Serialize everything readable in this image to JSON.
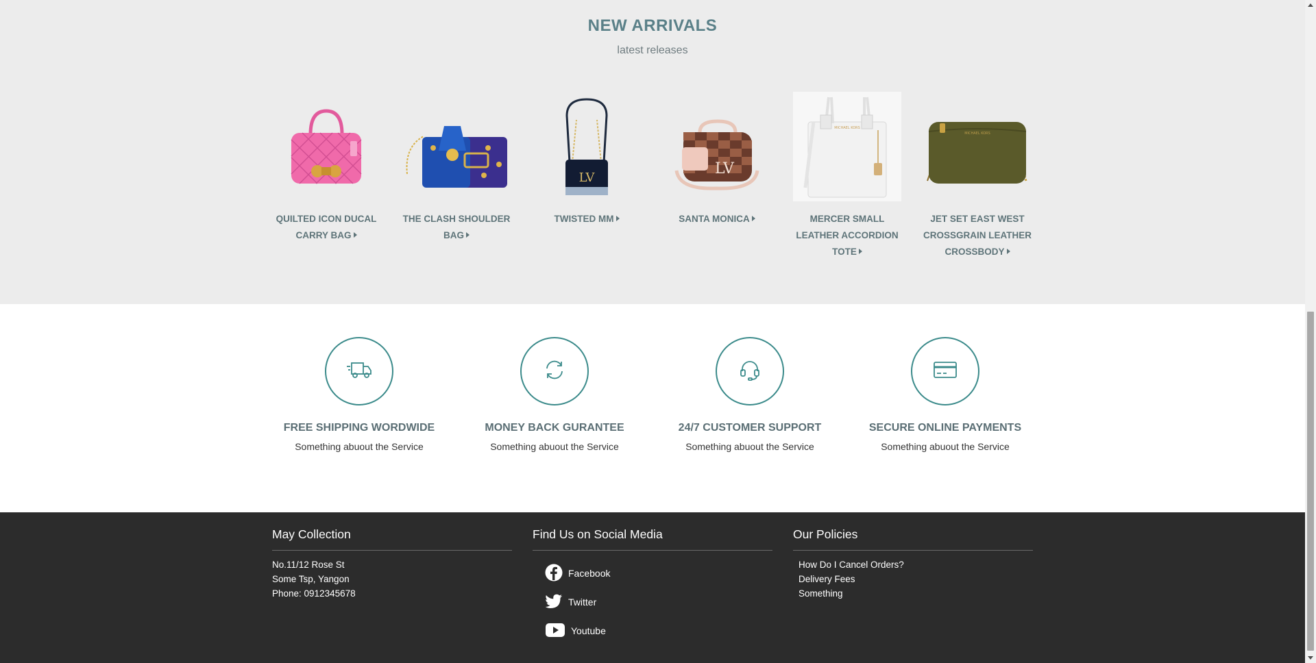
{
  "new_arrivals": {
    "title": "NEW ARRIVALS",
    "subtitle": "latest releases",
    "products": [
      {
        "name": "QUILTED ICON DUCAL CARRY BAG",
        "image": "pink-quilted-handbag"
      },
      {
        "name": "THE CLASH SHOULDER BAG",
        "image": "blue-shoulder-bag"
      },
      {
        "name": "TWISTED MM",
        "image": "navy-chain-bag"
      },
      {
        "name": "SANTA MONICA",
        "image": "checkered-brown-bag"
      },
      {
        "name": "MERCER SMALL LEATHER ACCORDION TOTE",
        "image": "white-tote-bag"
      },
      {
        "name": "JET SET EAST WEST CROSSGRAIN LEATHER CROSSBODY",
        "image": "olive-crossbody-bag"
      }
    ]
  },
  "services": [
    {
      "title": "FREE SHIPPING WORDWIDE",
      "desc": "Something abuout the Service",
      "icon": "truck-icon"
    },
    {
      "title": "MONEY BACK GURANTEE",
      "desc": "Something abuout the Service",
      "icon": "refresh-icon"
    },
    {
      "title": "24/7 CUSTOMER SUPPORT",
      "desc": "Something abuout the Service",
      "icon": "headset-icon"
    },
    {
      "title": "SECURE ONLINE PAYMENTS",
      "desc": "Something abuout the Service",
      "icon": "credit-card-icon"
    }
  ],
  "footer": {
    "about": {
      "title": "May Collection",
      "lines": [
        "No.11/12 Rose St",
        "Some Tsp, Yangon",
        "Phone: 0912345678"
      ]
    },
    "social": {
      "title": "Find Us on Social Media",
      "links": [
        {
          "label": "Facebook",
          "icon": "facebook-icon"
        },
        {
          "label": "Twitter",
          "icon": "twitter-icon"
        },
        {
          "label": "Youtube",
          "icon": "youtube-icon"
        }
      ]
    },
    "policies": {
      "title": "Our Policies",
      "links": [
        "How Do I Cancel Orders?",
        "Delivery Fees",
        "Something"
      ]
    }
  },
  "colors": {
    "accent": "#3a8a8a",
    "heading": "#5a8088",
    "arrivals_bg": "#ececec",
    "footer_bg": "#2c2c2c"
  }
}
